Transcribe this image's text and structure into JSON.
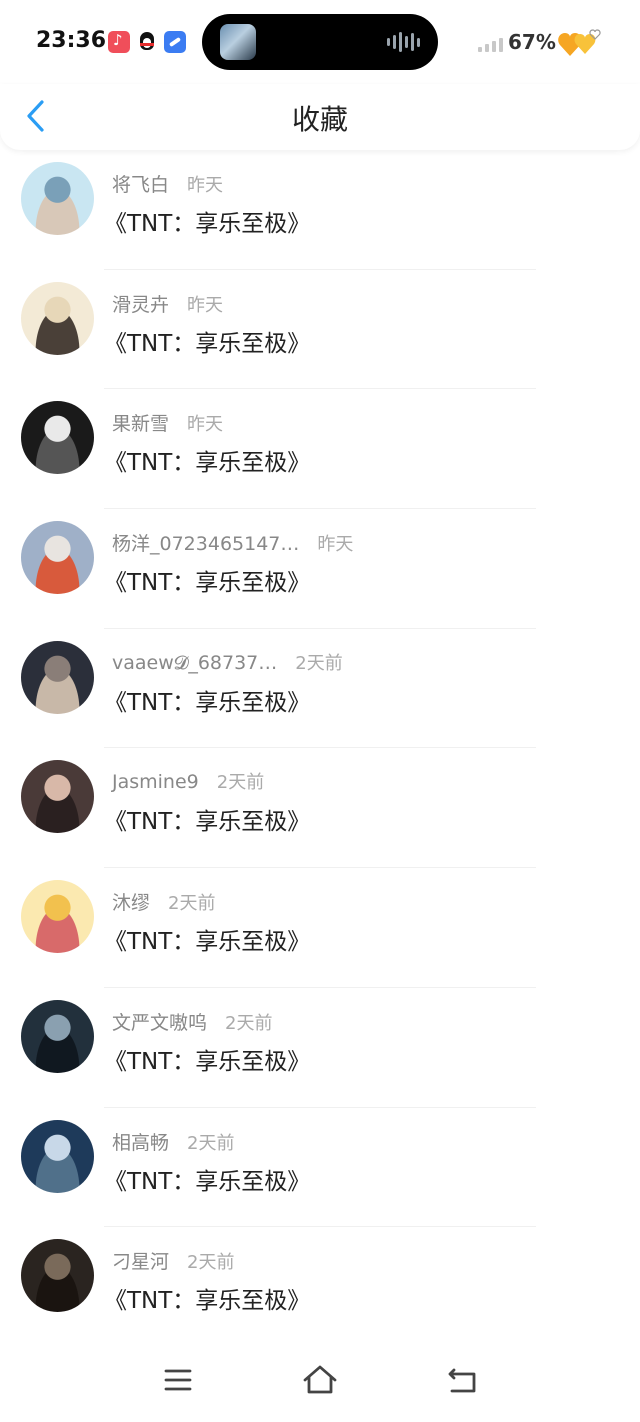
{
  "status_bar": {
    "time": "23:36",
    "battery": "67%",
    "icons": [
      "music-app-icon",
      "qq-penguin-icon",
      "blue-app-icon",
      "signal-icon",
      "hearts-icon"
    ]
  },
  "header": {
    "title": "收藏",
    "back_icon": "chevron-left-icon"
  },
  "favorites": [
    {
      "username": "将飞白",
      "time": "昨天",
      "title": "《TNT：享乐至极》"
    },
    {
      "username": "滑灵卉",
      "time": "昨天",
      "title": "《TNT：享乐至极》"
    },
    {
      "username": "果新雪",
      "time": "昨天",
      "title": "《TNT：享乐至极》"
    },
    {
      "username": "杨洋_0723465147…",
      "time": "昨天",
      "title": "《TNT：享乐至极》"
    },
    {
      "username": "vaaew𝓓_68737…",
      "time": "2天前",
      "title": "《TNT：享乐至极》"
    },
    {
      "username": "Jasmine9",
      "time": "2天前",
      "title": "《TNT：享乐至极》"
    },
    {
      "username": "沐缪",
      "time": "2天前",
      "title": "《TNT：享乐至极》"
    },
    {
      "username": "文严文嗷呜",
      "time": "2天前",
      "title": "《TNT：享乐至极》"
    },
    {
      "username": "相高畅",
      "time": "2天前",
      "title": "《TNT：享乐至极》"
    },
    {
      "username": "刁星河",
      "time": "2天前",
      "title": "《TNT：享乐至极》"
    }
  ],
  "avatar_colors": [
    [
      "#c9e6f2",
      "#7aa0b8",
      "#d8c8b8"
    ],
    [
      "#f3ead6",
      "#e7d7b8",
      "#4a4038"
    ],
    [
      "#1a1a1a",
      "#e9e9e9",
      "#555555"
    ],
    [
      "#9fb0c8",
      "#e8e4e0",
      "#d85a3c"
    ],
    [
      "#2b2f3a",
      "#8a7e78",
      "#c8b8a8"
    ],
    [
      "#4a3a38",
      "#d8b8a8",
      "#2a2020"
    ],
    [
      "#fbe9b0",
      "#f2c14e",
      "#d86a6a"
    ],
    [
      "#22303c",
      "#8aa0b0",
      "#101820"
    ],
    [
      "#1e3a5a",
      "#c8d8e8",
      "#50708a"
    ],
    [
      "#2a2420",
      "#7a6a5a",
      "#1a1410"
    ]
  ],
  "nav": {
    "menu_icon": "menu-icon",
    "home_icon": "home-icon",
    "back_icon": "back-icon"
  }
}
